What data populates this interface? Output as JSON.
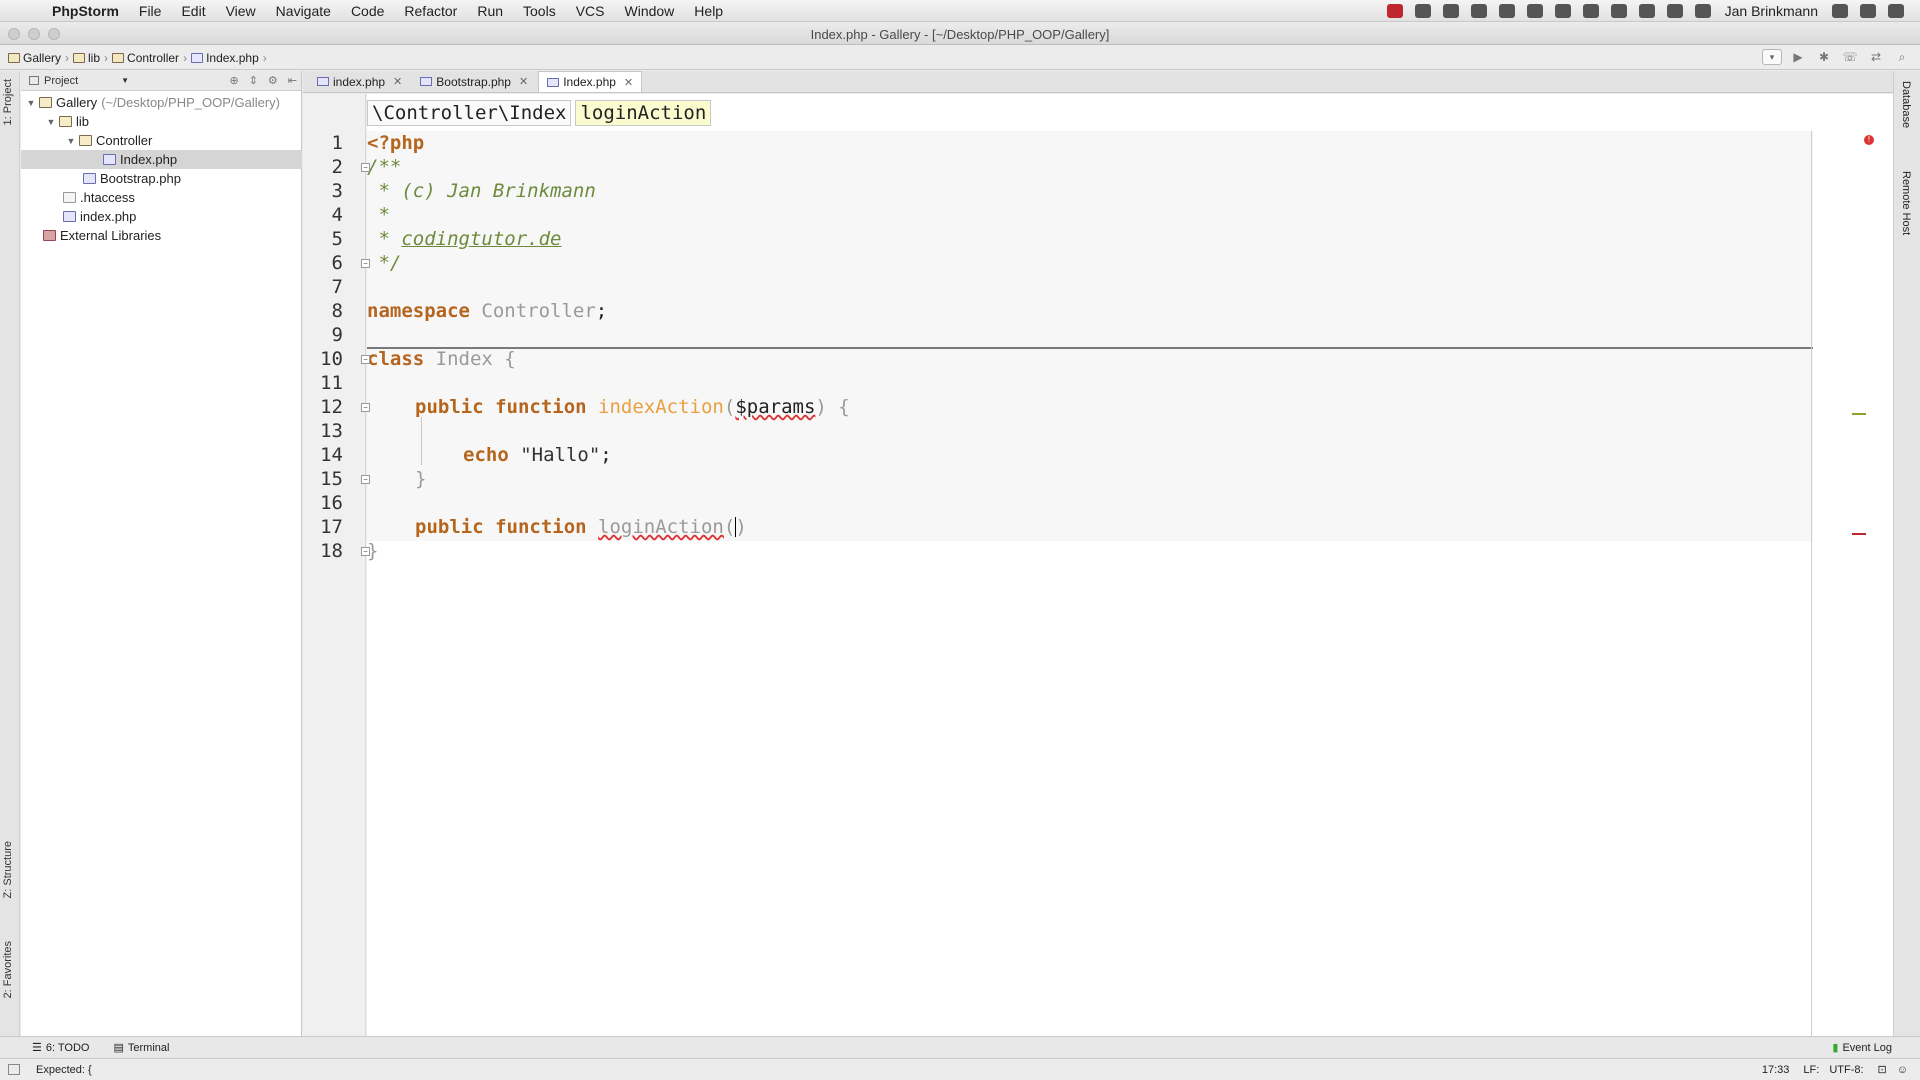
{
  "menubar": {
    "app": "PhpStorm",
    "items": [
      "File",
      "Edit",
      "View",
      "Navigate",
      "Code",
      "Refactor",
      "Run",
      "Tools",
      "VCS",
      "Window",
      "Help"
    ],
    "user": "Jan Brinkmann"
  },
  "window": {
    "title": "Index.php - Gallery - [~/Desktop/PHP_OOP/Gallery]"
  },
  "breadcrumb": [
    "Gallery",
    "lib",
    "Controller",
    "Index.php"
  ],
  "project": {
    "header": "Project",
    "tree": [
      {
        "label": "Gallery",
        "extra": "(~/Desktop/PHP_OOP/Gallery)"
      },
      {
        "label": "lib"
      },
      {
        "label": "Controller"
      },
      {
        "label": "Index.php"
      },
      {
        "label": "Bootstrap.php"
      },
      {
        "label": ".htaccess"
      },
      {
        "label": "index.php"
      },
      {
        "label": "External Libraries"
      }
    ]
  },
  "tabs": [
    {
      "label": "index.php"
    },
    {
      "label": "Bootstrap.php"
    },
    {
      "label": "Index.php"
    }
  ],
  "method_bar": {
    "class_path": "\\Controller\\Index",
    "method": "loginAction"
  },
  "code": {
    "line_numbers": [
      "1",
      "2",
      "3",
      "4",
      "5",
      "6",
      "7",
      "8",
      "9",
      "10",
      "11",
      "12",
      "13",
      "14",
      "15",
      "16",
      "17",
      "18"
    ],
    "l1": "<?php",
    "l2": "/**",
    "l3_star": " * ",
    "l3_text": "(c) Jan Brinkmann",
    "l4": " *",
    "l5_star": " * ",
    "l5_link": "codingtutor.de",
    "l6": " */",
    "l8_kw": "namespace",
    "l8_name": " Controller",
    "l8_semi": ";",
    "l10_kw": "class",
    "l10_name": " Index {",
    "l12_kw": "public function",
    "l12_fn": "indexAction",
    "l12_open": "(",
    "l12_param": "$params",
    "l12_close": ") {",
    "l14_kw": "echo",
    "l14_str": " \"Hallo\"",
    "l14_semi": ";",
    "l15": "}",
    "l17_kw": "public function",
    "l17_fn": "loginAction",
    "l17_paren": "()",
    "l18": "}"
  },
  "right_stripe": {
    "database": "Database",
    "remote_host": "Remote Host"
  },
  "left_stripe": {
    "project": "1: Project",
    "structure": "Z: Structure",
    "favorites": "2: Favorites"
  },
  "bottom_tools": {
    "todo": "6: TODO",
    "terminal": "Terminal",
    "event_log": "Event Log"
  },
  "status": {
    "message": "Expected: {",
    "position": "17:33",
    "line_sep": "LF:",
    "encoding": "UTF-8:"
  },
  "colors": {
    "keyword": "#b5651d",
    "comment": "#6e8b3d",
    "function": "#e8a040",
    "error": "#d33"
  }
}
